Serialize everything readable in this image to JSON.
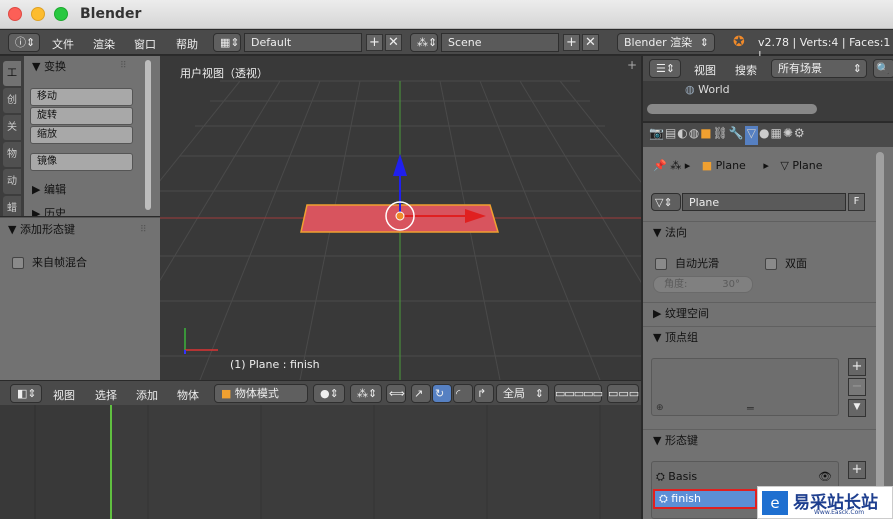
{
  "window": {
    "title": "Blender"
  },
  "info_header": {
    "menus": [
      "文件",
      "渲染",
      "窗口",
      "帮助"
    ],
    "screen_layout": "Default",
    "scene": "Scene",
    "render_engine": "Blender 渲染",
    "stats": "v2.78 | Verts:4 | Faces:1 |"
  },
  "toolshelf": {
    "tabs": [
      "工",
      "创",
      "关",
      "物",
      "动",
      "蜡"
    ],
    "transform_header": "变换",
    "transform_buttons": [
      "移动",
      "旋转",
      "缩放"
    ],
    "mirror_button": "镜像",
    "edit_header": "编辑",
    "history_header": "历史"
  },
  "operator_panel": {
    "header": "添加形态键",
    "from_mix_label": "来自帧混合"
  },
  "viewport": {
    "view_name": "用户视图（透视）",
    "object_info": "(1) Plane : finish",
    "accent_plane": "#d8545e",
    "grid_color": "#4b4b4b",
    "axis_red": "#d33b3b",
    "axis_green": "#4ac24a"
  },
  "view3d_header": {
    "menus": [
      "视图",
      "选择",
      "添加",
      "物体"
    ],
    "mode": "物体模式",
    "pivot": "全局"
  },
  "outliner": {
    "menus": [
      "视图",
      "搜索"
    ],
    "filter": "所有场景",
    "world_item": "World"
  },
  "properties": {
    "breadcrumb_object": "Plane",
    "breadcrumb_mesh": "Plane",
    "datablock_name": "Plane",
    "datablock_fake_user": "F",
    "normals_header": "法向",
    "auto_smooth_label": "自动光滑",
    "double_sided_label": "双面",
    "angle_label": "角度:",
    "angle_value": "30°",
    "texture_space_header": "纹理空间",
    "vertex_groups_header": "顶点组",
    "shape_keys_header": "形态键",
    "shape_keys": [
      "Basis",
      "finish"
    ],
    "selected_key": "finish",
    "highlight_color": "#e02020",
    "selected_bg": "#5c8fd6"
  },
  "watermark": {
    "text": "易采站长站",
    "subtext": "Www.Easck.Com"
  }
}
